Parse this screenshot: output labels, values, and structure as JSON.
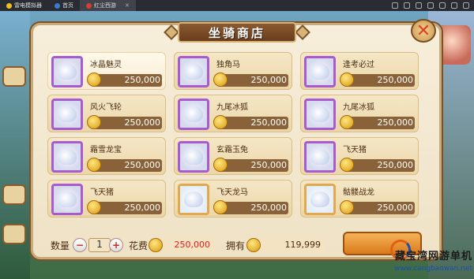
{
  "emulator": {
    "app_title": "雷电模拟器",
    "tabs": [
      {
        "label": "首页"
      },
      {
        "label": "红尘西游"
      }
    ]
  },
  "shop": {
    "title": "坐骑商店",
    "items": [
      {
        "name": "冰晶魅灵",
        "price": "250,000",
        "frame": "purple",
        "selected": true
      },
      {
        "name": "独角马",
        "price": "250,000",
        "frame": "purple"
      },
      {
        "name": "逢考必过",
        "price": "250,000",
        "frame": "purple"
      },
      {
        "name": "风火飞轮",
        "price": "250,000",
        "frame": "purple"
      },
      {
        "name": "九尾冰狐",
        "price": "250,000",
        "frame": "purple"
      },
      {
        "name": "九尾冰狐",
        "price": "250,000",
        "frame": "purple"
      },
      {
        "name": "霜雪龙宝",
        "price": "250,000",
        "frame": "purple"
      },
      {
        "name": "玄霜玉兔",
        "price": "250,000",
        "frame": "purple"
      },
      {
        "name": "飞天猪",
        "price": "250,000",
        "frame": "purple"
      },
      {
        "name": "飞天猪",
        "price": "250,000",
        "frame": "purple"
      },
      {
        "name": "飞天龙马",
        "price": "250,000",
        "frame": "gold"
      },
      {
        "name": "骷髅战龙",
        "price": "250,000",
        "frame": "gold"
      }
    ],
    "quantity_label": "数量",
    "quantity": "1",
    "minus": "−",
    "plus": "+",
    "cost_label": "花费",
    "cost": "250,000",
    "owned_label": "拥有",
    "owned": "119,999"
  },
  "watermark": {
    "text": "藏宝湾网游单机",
    "url": "www.cangbaowan.net"
  },
  "colors": {
    "frame_purple": "#a75bd0",
    "frame_gold": "#e2a84d",
    "cost_red": "#e0201c"
  }
}
